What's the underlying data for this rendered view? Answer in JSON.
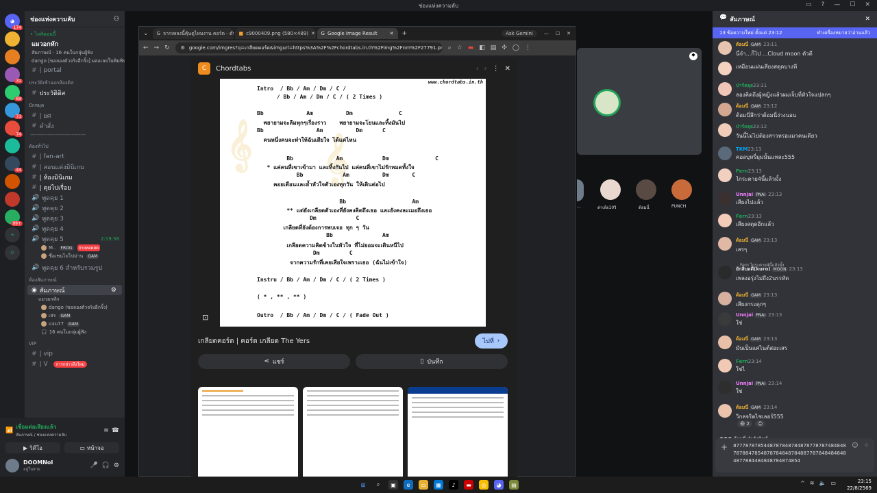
{
  "window": {
    "title": "ช่องแห่งความลับ"
  },
  "server_rail": {
    "badges": [
      "174",
      "31",
      "69",
      "73",
      "74",
      "44",
      "99+"
    ]
  },
  "channels": {
    "server_name": "ช่องแห่งความลับ",
    "voice_now": "• ไลฟ์ตอนนี้",
    "voice_now_title": "แมวอกหัก",
    "voice_now_sub": "สัมภาษณ์ · 16 คนในกลุ่มผู้ฟัง",
    "voice_now_sub2": "dango [ขอลองตัวจริงอีกรั้ง] ผลอเลยในพิมพิน...",
    "portal": "| portal",
    "cat_news": "ประวัติเข้าออกห้องดิส",
    "news_channel": "ประวัติดิส",
    "cat_pin": "ปักหมุด",
    "pin1": "| ยศ",
    "pin2": "คำสั่ง",
    "divider": "--------------------------------",
    "cat_chat": "ห้องทั่วไป",
    "chat_items": [
      "| fan-art",
      "| สอนแต่งมินิเกม",
      "| ห้องมินิเกม",
      "| คุยไปเรื่อย"
    ],
    "voice_items": [
      "พูดคุย 1",
      "พูดคุย 2",
      "พูดคุย 3",
      "พูดคุย 4",
      "พูดคุย 5",
      "พูดคุย 6 สำหรับรวมรูป"
    ],
    "voice5_time": "2:19:58",
    "voice5_user1": "M..",
    "voice5_user1_tag": "FROG",
    "voice5_user1_badge": "ถ่ายทอดสด",
    "voice5_user2": "ชื่อเชนไม่ไปม่าน",
    "voice5_user2_tag": "GAM",
    "cat_stage": "ห้องสัมภาษณ์",
    "stage_channel": "สัมภาษณ์",
    "stage_sub": "แมวอกหัก",
    "stage_user1": "dango (ขอลองตัวจริงอีกรั้ง)",
    "stage_user2": "เสร",
    "stage_user2_tag": "GAM",
    "stage_user3": "แจม77",
    "stage_user3_tag": "GAM",
    "stage_listeners": "16 คนในกลุ่มผู้ฟัง",
    "cat_vip": "VIP",
    "vip1": "| vip",
    "vip2": "| V",
    "new_mentions": "การกล่าวถึงใหม่"
  },
  "voice_panel": {
    "status": "เชื่อมต่อเสียงแล้ว",
    "location": "สัมภาษณ์ / ช่องแห่งความลับ",
    "video_label": "วิดีโอ",
    "screen_label": "หน้าจอ"
  },
  "user": {
    "name": "DOOMNoI",
    "status": "อยู่ในสาย"
  },
  "browser": {
    "tabs": [
      {
        "label": "จากเพลงนี้คุ้นดูไหมงาน คอร์ด - ดับ"
      },
      {
        "label": "c9000409.png (580×489)"
      },
      {
        "label": "Google Image Result"
      }
    ],
    "ask_label": "Ask Gemini",
    "url": "google.com/imgres?q=เกลียดคอร์ด&imgurl=https%3A%2F%2Fchordtabs.in.th%2Fimg%2Fnm%2F27791.png&im...",
    "viewer_site": "Chordtabs",
    "result_title": "เกลียดคอร์ด | คอร์ด เกลียด The Yers",
    "visit_label": "ไปที่",
    "share_label": "แชร์",
    "save_label": "บันทึก"
  },
  "chord_sheet": {
    "watermark_url": "www.chordtabs.in.th",
    "lines": [
      "Intro  / Bb / Am / Dm / C /",
      "      / Bb / Am / Dm / C / ( 2 Times )",
      "Bb             Am          Dm              C",
      "  พยายามจะลืมทุกๆเรื่องราว    พยายามจะโยนและทิ้งมันไป",
      "Bb                Am          Dm      C",
      "  คนหนึ่งคนจะทำให้ฉันเสียใจ ได้แค่ไหน",
      "         Bb             Am            Dm              C",
      "   * แค่คนที่เขาเข้ามา และทิ้งกันไป แค่คนที่เขาไม่รักหมดทั้งใจ",
      "            Bb            Am          Dm       C",
      "     คอยเตือนและย้ำหัวใจตัวเองทุกวัน ให้เดินต่อไป",
      "                         Bb                    Am",
      "         ** แต่ยังเกลียดตัวเองที่ยังคงคิดถึงเธอ และยังคงละเมอถึงเธอ",
      "                Dm            C",
      "        เกลียดที่ยังต้องการพบเจอ ทุก ๆ วัน",
      "                     Bb               Am",
      "         เกลียดความคิดข้างในหัวใจ ที่ไม่ยอมจะเดินหนีไป",
      "                 Dm         C",
      "          จากความรักที่เคยเสียใจเพราะเธอ (ฉันไม่เข้าใจ)",
      "Instru / Bb / Am / Dm / C / ( 2 Times )",
      "( * , ** , ** )",
      "Outro  / Bb / Am / Dm / C / ( Fade Out )"
    ]
  },
  "stage": {
    "participants": [
      "...",
      "ต่าเล้ย10วิ",
      "ด้อมนี่",
      "PUNCH"
    ]
  },
  "chat": {
    "channel": "สัมภาษณ์",
    "new_banner": "13 ข้อความใหม่ ตั้งแต่ 23:12",
    "mark_read": "ทำเครื่องหมายว่าอ่านแล้ว",
    "messages": [
      {
        "name": "ด้อมนี่",
        "tag": "GAM",
        "time": "23:11",
        "text": "นี่จำ...ก็ไป ...Cloud moon ตัวดี",
        "color": "#f0b232"
      },
      {
        "name": "",
        "tag": "",
        "time": "",
        "text": "เหมือนแผ่นเสียงสดุดบางที",
        "color": "#dbdee1"
      },
      {
        "name": "ป่าร์คยุย",
        "tag": "",
        "time": "23:11",
        "text": "ลองคิดถึงผู้หญิงแล้วผมเจ็บที่หัวใจแปลกๆ",
        "color": "#23a55a"
      },
      {
        "name": "ด้อมนี่",
        "tag": "GAM",
        "time": "23:12",
        "text": "ด้อมนี่ลึกว่าด้อมนี่ง่วงนอน",
        "color": "#f0b232"
      },
      {
        "name": "ป่าร์คยุย",
        "tag": "",
        "time": "23:12",
        "text": "วันนี้ไม่ไปต้องสาวหรอแมวคนเดียว",
        "color": "#23a55a"
      },
      {
        "name": "TKM",
        "tag": "",
        "time": "23:13",
        "text": "คอลบุหรี่มุมนั้นแหละ555",
        "color": "#00a8fc"
      },
      {
        "name": "Fern",
        "tag": "",
        "time": "23:13",
        "text": "ไกระตาย4นี้แล้วมั้ง",
        "color": "#23a55a"
      },
      {
        "name": "Unnjai",
        "tag": "PNAI",
        "time": "23:13",
        "text": "เสียงไปแล้ว",
        "color": "#f47fff"
      },
      {
        "name": "Fern",
        "tag": "",
        "time": "23:13",
        "text": "เสียงสดุดอีกแล้ว",
        "color": "#23a55a"
      },
      {
        "name": "ด้อมนี่",
        "tag": "GAM",
        "time": "23:13",
        "text": "เสรๆ",
        "color": "#f0b232"
      },
      {
        "name": "ยักสิบดดี(kuro)",
        "tag": "MOON",
        "time": "23:13",
        "text": "เพลงอรุ่งไม่ถึง2นรรทัด",
        "color": "#dbdee1"
      },
      {
        "name": "ด้อมนี่",
        "tag": "GAM",
        "time": "23:13",
        "text": "เสียงกระตุกๆ",
        "color": "#f0b232"
      },
      {
        "name": "Unnjai",
        "tag": "PNAI",
        "time": "23:13",
        "text": "ใช่",
        "color": "#f47fff"
      },
      {
        "name": "ด้อมนี่",
        "tag": "GAM",
        "time": "23:13",
        "text": "มันเป็นแค่ไนต์สอะเสร",
        "color": "#f0b232"
      },
      {
        "name": "Fern",
        "tag": "",
        "time": "23:14",
        "text": "ใช่ไ",
        "color": "#23a55a"
      },
      {
        "name": "Unnjai",
        "tag": "PNAI",
        "time": "23:14",
        "text": "ใช่",
        "color": "#f47fff"
      },
      {
        "name": "ด้อมนี่",
        "tag": "GAM",
        "time": "23:14",
        "text": "วิกลจริตไชเลอร์555",
        "color": "#f0b232"
      }
    ],
    "reply_ref": "Fern  ไกระตาย4นี้แล้วมั้ง",
    "typing": "ด้อมนี่ กำลังพิมพ์...",
    "reaction_count": "2",
    "composer_value": "877787878544878784878487877878748484878788478548787848487848877878484848484877884484848784874854"
  },
  "taskbar": {
    "time": "23:15",
    "date": "22/8/2569"
  }
}
